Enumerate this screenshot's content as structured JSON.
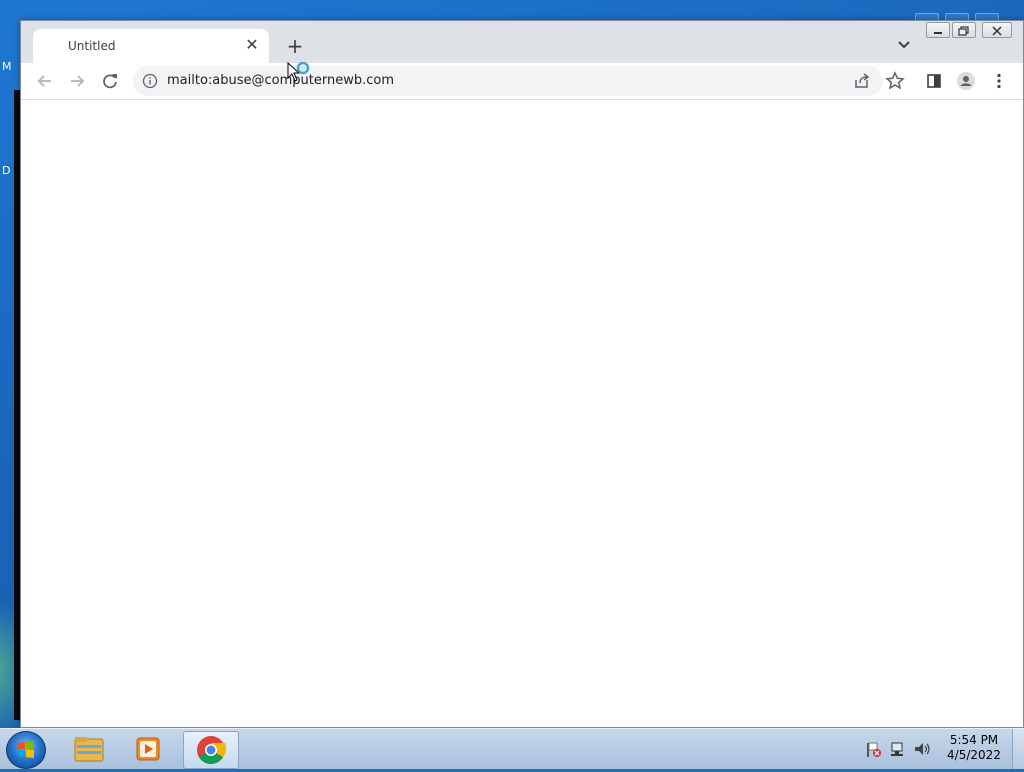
{
  "desktop": {
    "fragment_top": "M",
    "fragment_mid": "D"
  },
  "browser": {
    "tab": {
      "title": "Untitled",
      "close_glyph": "✕"
    },
    "new_tab_glyph": "+",
    "address": {
      "url": "mailto:abuse@computernewb.com"
    },
    "icons": [
      "back-icon",
      "forward-icon",
      "reload-icon",
      "info-icon",
      "share-icon",
      "star-icon",
      "side-panel-icon",
      "profile-icon",
      "menu-icon",
      "tab-search-icon"
    ]
  },
  "taskbar": {
    "apps": [
      "windows-explorer",
      "media-player",
      "google-chrome"
    ],
    "clock": {
      "time": "5:54 PM",
      "date": "4/5/2022"
    }
  }
}
